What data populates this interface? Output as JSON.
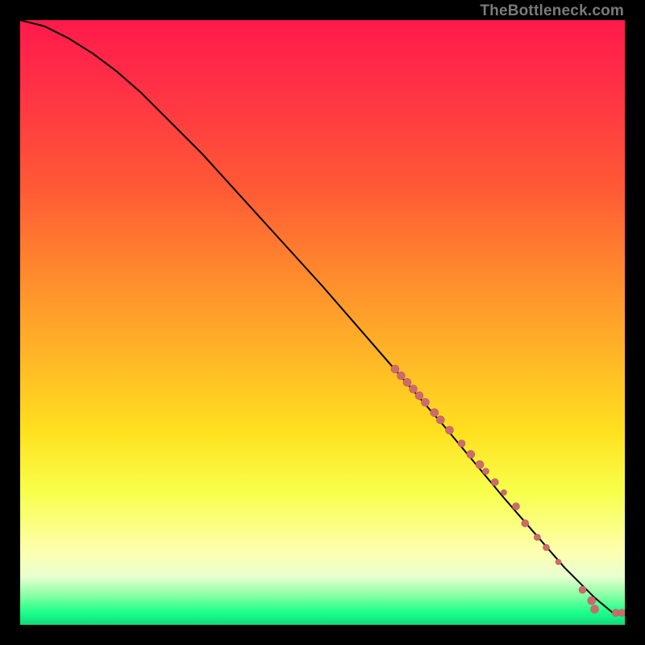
{
  "watermark": "TheBottleneck.com",
  "colors": {
    "background": "#000000",
    "gradient_top": "#ff1a4b",
    "gradient_mid1": "#ff8a2d",
    "gradient_mid2": "#ffe01f",
    "gradient_bottom": "#12d979",
    "curve": "#000000",
    "marker_fill": "#cd6b6b",
    "marker_stroke": "#b85c5c"
  },
  "chart_data": {
    "type": "line",
    "title": "",
    "xlabel": "",
    "ylabel": "",
    "xlim": [
      0,
      100
    ],
    "ylim": [
      0,
      100
    ],
    "series": [
      {
        "name": "curve",
        "x": [
          0,
          4,
          8,
          12,
          16,
          20,
          30,
          40,
          50,
          60,
          70,
          80,
          90,
          95,
          98,
          100
        ],
        "y": [
          100,
          99,
          97,
          94.5,
          91.5,
          88,
          78,
          67,
          56,
          44.5,
          33,
          21,
          9.5,
          4.5,
          2,
          2
        ]
      }
    ],
    "markers": [
      {
        "x": 62.0,
        "y": 42.3,
        "r": 5
      },
      {
        "x": 63.0,
        "y": 41.2,
        "r": 5
      },
      {
        "x": 64.0,
        "y": 40.1,
        "r": 5
      },
      {
        "x": 65.0,
        "y": 39.0,
        "r": 5
      },
      {
        "x": 66.0,
        "y": 37.9,
        "r": 5
      },
      {
        "x": 67.0,
        "y": 36.8,
        "r": 5
      },
      {
        "x": 68.5,
        "y": 35.1,
        "r": 5
      },
      {
        "x": 69.5,
        "y": 33.9,
        "r": 5
      },
      {
        "x": 71.0,
        "y": 32.2,
        "r": 5
      },
      {
        "x": 73.0,
        "y": 30.0,
        "r": 4.5
      },
      {
        "x": 74.5,
        "y": 28.2,
        "r": 5
      },
      {
        "x": 76.0,
        "y": 26.5,
        "r": 5
      },
      {
        "x": 77.0,
        "y": 25.4,
        "r": 4
      },
      {
        "x": 78.5,
        "y": 23.6,
        "r": 4.5
      },
      {
        "x": 80.0,
        "y": 21.9,
        "r": 3.5
      },
      {
        "x": 82.0,
        "y": 19.6,
        "r": 4.5
      },
      {
        "x": 83.5,
        "y": 16.8,
        "r": 4.5
      },
      {
        "x": 85.5,
        "y": 14.5,
        "r": 4
      },
      {
        "x": 87.0,
        "y": 12.8,
        "r": 4
      },
      {
        "x": 89.0,
        "y": 10.4,
        "r": 3.5
      },
      {
        "x": 93.0,
        "y": 5.8,
        "r": 4.5
      },
      {
        "x": 94.5,
        "y": 4.0,
        "r": 5
      },
      {
        "x": 95.0,
        "y": 2.6,
        "r": 5
      },
      {
        "x": 98.5,
        "y": 2.0,
        "r": 4.5
      },
      {
        "x": 99.5,
        "y": 2.0,
        "r": 4.5
      }
    ]
  }
}
